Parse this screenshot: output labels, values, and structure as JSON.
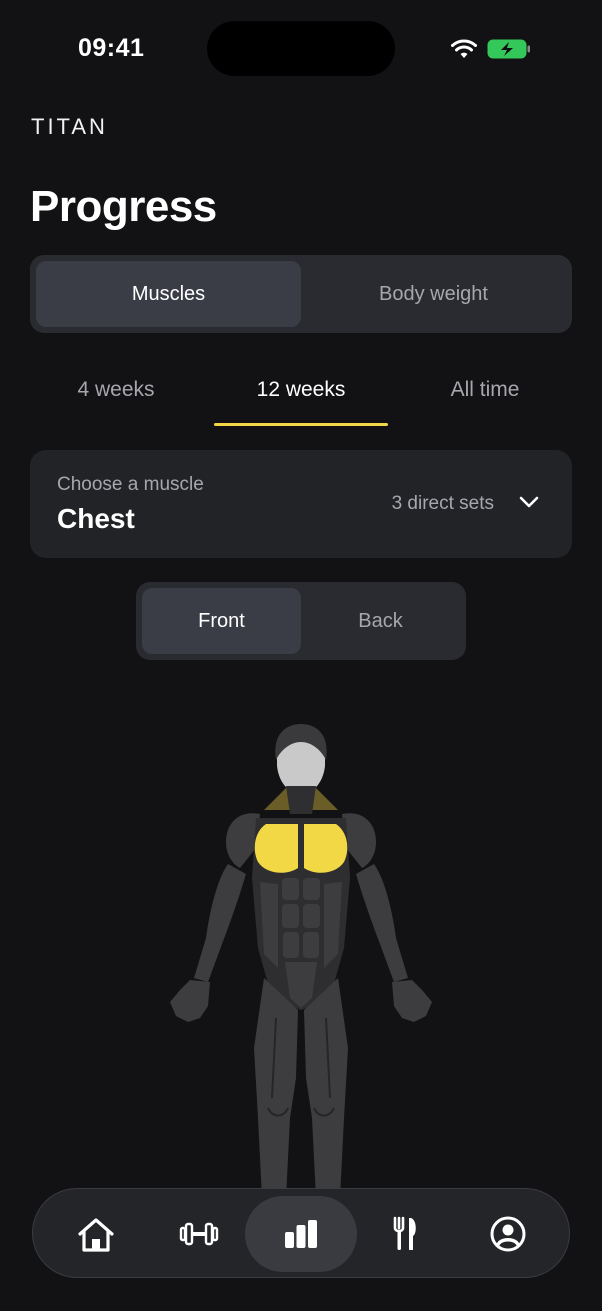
{
  "status_bar": {
    "time": "09:41",
    "icons": [
      "wifi-icon",
      "battery-charging-icon"
    ]
  },
  "brand": "TITAN",
  "page_title": "Progress",
  "view_switch": {
    "options": [
      "Muscles",
      "Body weight"
    ],
    "selected": "Muscles"
  },
  "range_tabs": {
    "items": [
      "4 weeks",
      "12 weeks",
      "All time"
    ],
    "selected": "12 weeks"
  },
  "muscle_picker": {
    "hint": "Choose a muscle",
    "value": "Chest",
    "sets": "3 direct sets",
    "icon": "chevron-down-icon"
  },
  "side_switch": {
    "options": [
      "Front",
      "Back"
    ],
    "selected": "Front"
  },
  "body_map": {
    "highlighted_muscle": "chest",
    "highlight_color": "#f2d845",
    "muscle_color": "#3d3d3f",
    "skin_color": "#c9c9c9"
  },
  "bottom_nav": {
    "items": [
      "home-icon",
      "dumbbell-icon",
      "stats-icon",
      "fork-knife-icon",
      "profile-icon"
    ],
    "selected": "stats-icon"
  },
  "colors": {
    "background": "#121214",
    "accent": "#f2d845",
    "card": "#222327",
    "battery": "#34c759"
  }
}
